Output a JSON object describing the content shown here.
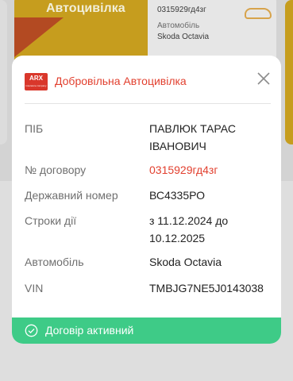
{
  "background": {
    "card_title": "Автоцивілка",
    "contract_number": "0315929гд4зг",
    "car_label": "Автомобіль",
    "car_value": "Skoda Octavia"
  },
  "modal": {
    "logo_text": "ARX",
    "title": "Добровільна Автоцивілка",
    "rows": [
      {
        "label": "ПІБ",
        "value": "ПАВЛЮК ТАРАС ІВАНОВИЧ"
      },
      {
        "label": "№ договору",
        "value": "0315929гд4зг"
      },
      {
        "label": "Державний номер",
        "value": "ВС4335РО"
      },
      {
        "label": "Строки дії",
        "value": "з 11.12.2024 до 10.12.2025"
      },
      {
        "label": "Автомобіль",
        "value": "Skoda Octavia"
      },
      {
        "label": "VIN",
        "value": "TMBJG7NE5J0143038"
      }
    ],
    "status_text": "Договір активний"
  },
  "colors": {
    "accent_red": "#e2402f",
    "status_green": "#3ecb87",
    "brand_yellow": "#c69d1e"
  },
  "icons": {
    "close": "close-icon",
    "status": "check-circle-icon",
    "car": "car-icon"
  }
}
